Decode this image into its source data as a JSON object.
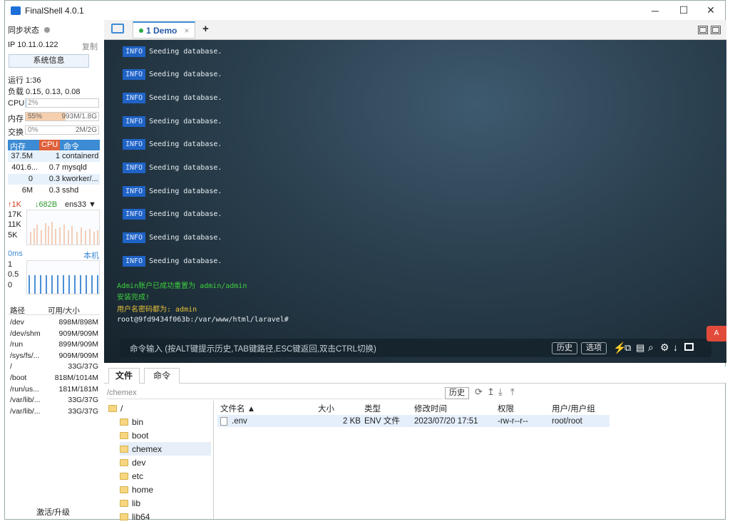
{
  "window": {
    "title": "FinalShell 4.0.1",
    "controls": [
      "─",
      "☐",
      "✕"
    ]
  },
  "left": {
    "sync_label": "同步状态",
    "ip_label": "IP  10.11.0.122",
    "copy_label": "复制",
    "sysinfo_button": "系统信息",
    "uptime": "运行 1:36",
    "load": "负载 0.15, 0.13, 0.08",
    "cpu": {
      "label": "CPU",
      "value": "2%",
      "fraction": 0.02
    },
    "mem": {
      "label": "内存",
      "percent": "55%",
      "value": "993M/1.8G",
      "fraction": 0.55
    },
    "swap": {
      "label": "交换",
      "percent": "0%",
      "value": "2M/2G",
      "fraction": 0.0
    },
    "proc_headers": [
      "内存",
      "CPU",
      "命令"
    ],
    "processes": [
      {
        "mem": "37.5M",
        "cpu": "1",
        "cmd": "containerd"
      },
      {
        "mem": "401.6...",
        "cpu": "0.7",
        "cmd": "mysqld"
      },
      {
        "mem": "0",
        "cpu": "0.3",
        "cmd": "kworker/..."
      },
      {
        "mem": "6M",
        "cpu": "0.3",
        "cmd": "sshd"
      }
    ],
    "net": {
      "up": "↑1K",
      "down": "↓682B",
      "iface": "ens33 ▼",
      "scale": [
        "17K",
        "11K",
        "5K"
      ]
    },
    "ping": {
      "label": "0ms",
      "host": "本机",
      "scale": [
        "1",
        "0.5",
        "0"
      ]
    },
    "disk_headers": [
      "路径",
      "可用/大小"
    ],
    "disks": [
      {
        "path": "/dev",
        "size": "898M/898M"
      },
      {
        "path": "/dev/shm",
        "size": "909M/909M"
      },
      {
        "path": "/run",
        "size": "899M/909M"
      },
      {
        "path": "/sys/fs/...",
        "size": "909M/909M"
      },
      {
        "path": "/",
        "size": "33G/37G"
      },
      {
        "path": "/boot",
        "size": "818M/1014M"
      },
      {
        "path": "/run/us...",
        "size": "181M/181M"
      },
      {
        "path": "/var/lib/...",
        "size": "33G/37G"
      },
      {
        "path": "/var/lib/...",
        "size": "33G/37G"
      }
    ],
    "activate_label": "激活/升级"
  },
  "tabs": {
    "active": "1 Demo",
    "close": "×",
    "add": "+"
  },
  "terminal": {
    "info_badge": "INFO",
    "log_lines": [
      "Seeding database.",
      "Seeding database.",
      "Seeding database.",
      "Seeding database.",
      "Seeding database.",
      "Seeding database.",
      "Seeding database.",
      "Seeding database.",
      "Seeding database.",
      "Seeding database."
    ],
    "result_lines": [
      {
        "text": "Admin账户已成功重置为 admin/admin",
        "color": "#3ccf3c"
      },
      {
        "text": "安装完成!",
        "color": "#3ccf3c"
      },
      {
        "text": "用户名密码都为: admin",
        "color": "#e8c13a"
      },
      {
        "text": "root@9fd9434f063b:/var/www/html/laravel#",
        "color": "#e8eef2"
      }
    ],
    "command_hint": "命令输入 (按ALT键提示历史,TAB键路径,ESC键返回,双击CTRL切换)",
    "history_button": "历史",
    "options_button": "选项"
  },
  "files": {
    "tab_files": "文件",
    "tab_commands": "命令",
    "path": "/chemex",
    "history_button": "历史",
    "tree": [
      {
        "name": "/",
        "level": 0
      },
      {
        "name": "bin",
        "level": 1
      },
      {
        "name": "boot",
        "level": 1
      },
      {
        "name": "chemex",
        "level": 1
      },
      {
        "name": "dev",
        "level": 1
      },
      {
        "name": "etc",
        "level": 1
      },
      {
        "name": "home",
        "level": 1
      },
      {
        "name": "lib",
        "level": 1
      },
      {
        "name": "lib64",
        "level": 1
      }
    ],
    "columns": [
      "文件名 ▲",
      "大小",
      "类型",
      "修改时间",
      "权限",
      "用户/用户组"
    ],
    "rows": [
      {
        "name": ".env",
        "size": "2 KB",
        "type": "ENV 文件",
        "mtime": "2023/07/20 17:51",
        "perm": "-rw-r--r--",
        "owner": "root/root"
      }
    ]
  }
}
